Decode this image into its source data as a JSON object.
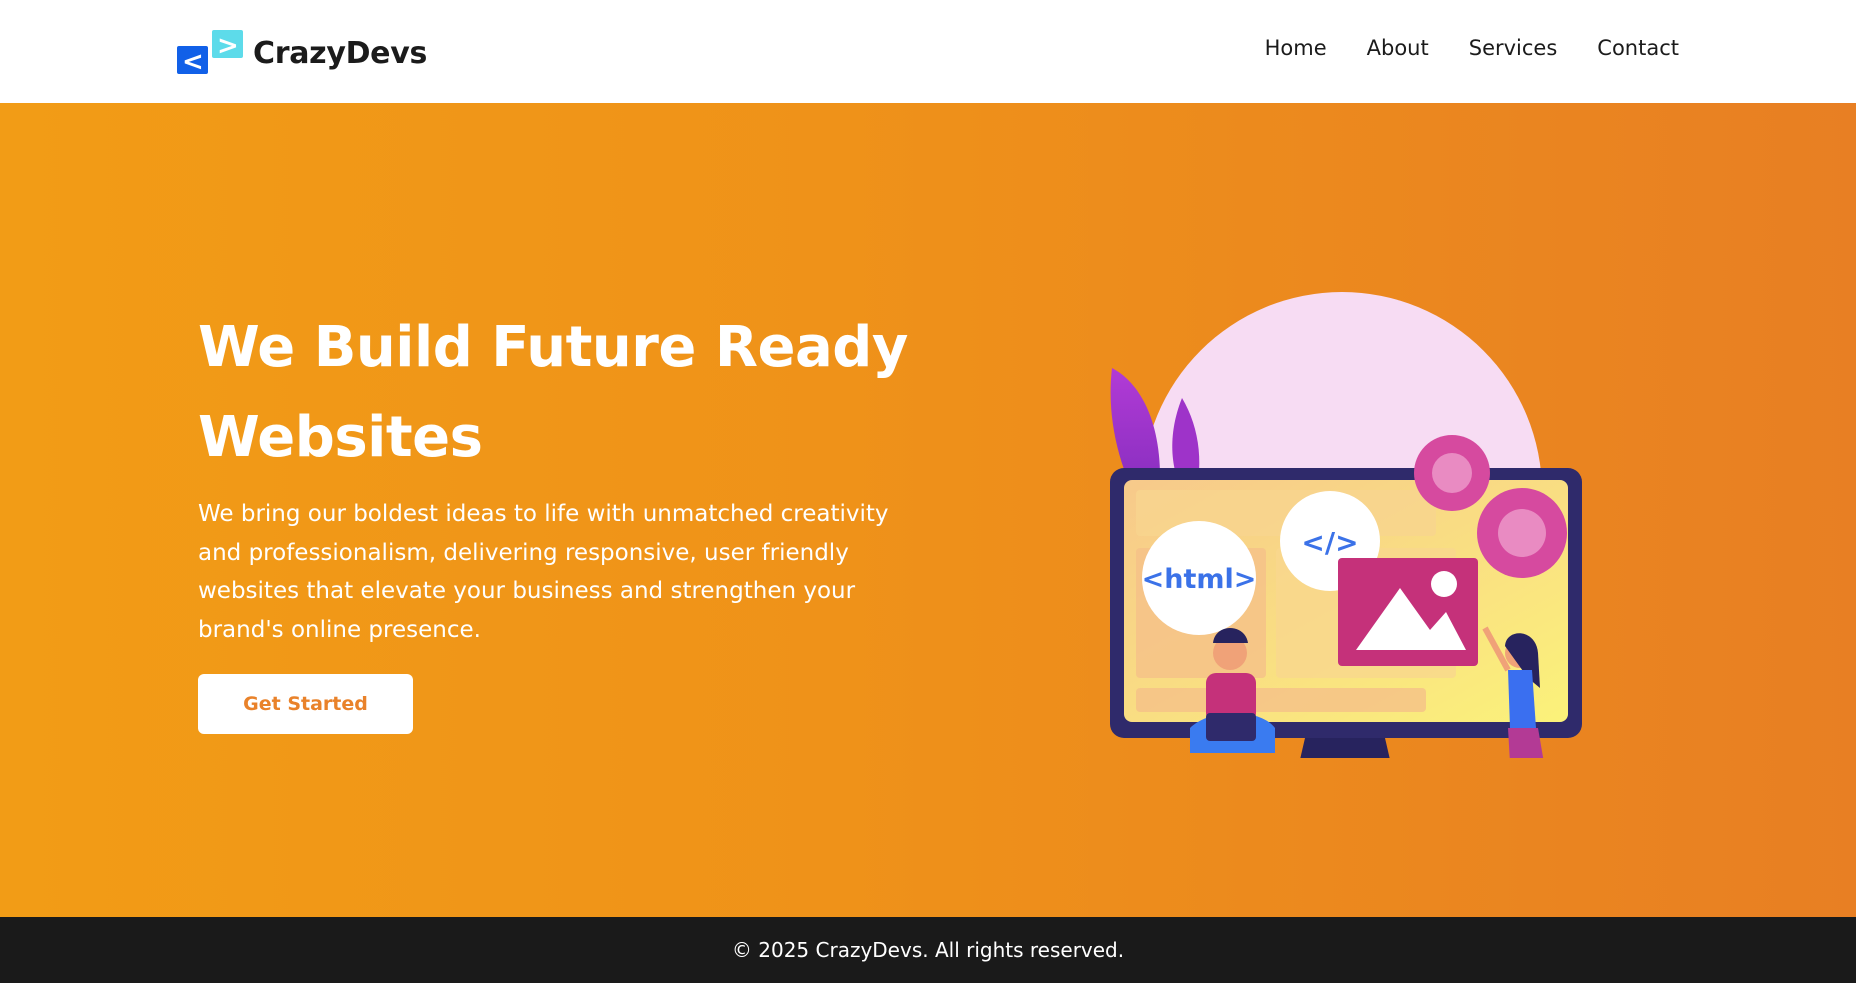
{
  "brand": {
    "name": "CrazyDevs",
    "logo_left_glyph": "<",
    "logo_right_glyph": ">",
    "color_primary": "#1160e8",
    "color_secondary": "#5ddbea"
  },
  "nav": {
    "items": [
      {
        "label": "Home"
      },
      {
        "label": "About"
      },
      {
        "label": "Services"
      },
      {
        "label": "Contact"
      }
    ]
  },
  "hero": {
    "title": "We Build Future Ready Websites",
    "description": "We bring our boldest ideas to life with unmatched creativity and professionalism, delivering responsive, user friendly websites that elevate your business and strengthen your brand's online presence.",
    "cta_label": "Get Started",
    "background_start": "#f29c16",
    "background_end": "#e87f23",
    "illustration": {
      "html_tag": "<html>",
      "code_tag": "</>"
    }
  },
  "footer": {
    "copyright": "© 2025 CrazyDevs. All rights reserved."
  }
}
